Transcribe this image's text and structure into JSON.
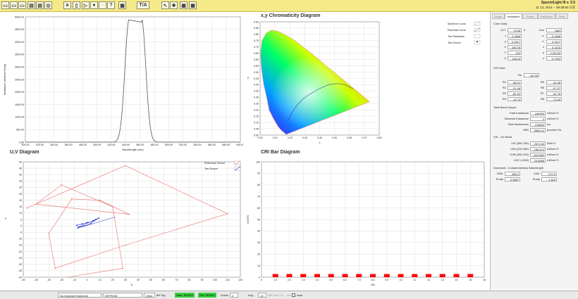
{
  "app": {
    "title": "SpectriLight III v. 3.5",
    "date": "11 13, 2014 -- 09:28:50 오후"
  },
  "toolbar": {
    "buttons": [
      {
        "name": "open-icon",
        "glyph": "▭"
      },
      {
        "name": "save-icon",
        "glyph": "▭"
      },
      {
        "name": "save-as-icon",
        "glyph": "▭"
      },
      {
        "name": "print-icon",
        "glyph": "▤"
      },
      {
        "name": "export-icon",
        "glyph": "▤"
      },
      {
        "name": "settings-icon",
        "glyph": "◎"
      },
      {
        "name": "text-icon",
        "glyph": "a"
      },
      {
        "name": "copy-icon",
        "glyph": "▯"
      },
      {
        "name": "run-icon",
        "glyph": "▷"
      },
      {
        "name": "record-icon",
        "glyph": "●"
      },
      {
        "name": "stop-icon",
        "glyph": "◌"
      },
      {
        "name": "help-icon",
        "glyph": "?"
      },
      {
        "name": "image-icon",
        "glyph": "▦"
      },
      {
        "name": "annotate-button",
        "glyph": "T/A"
      },
      {
        "name": "cursor-icon",
        "glyph": "↖"
      },
      {
        "name": "pan-icon",
        "glyph": "✥"
      },
      {
        "name": "zoom-icon",
        "glyph": "▦"
      },
      {
        "name": "autoscale-icon",
        "glyph": "▦"
      }
    ]
  },
  "spectrum": {
    "ylabel": "Irradiance (uW/cm^2/nm)",
    "xlabel": "Wavelength (nm)",
    "yticks": [
      "5000.00",
      "4500.00",
      "4000.00",
      "3500.00",
      "3000.00",
      "2500.00",
      "2000.00",
      "1500.00",
      "1000.00",
      "500.00",
      "0.00"
    ],
    "xticks": [
      "300.00",
      "320.00",
      "340.00",
      "360.00",
      "380.00",
      "400.00",
      "420.00",
      "440.00",
      "460.00",
      "480.00",
      "500.00",
      "520.00",
      "540.00",
      "560.00",
      "580.00",
      "600.00"
    ]
  },
  "cie": {
    "title": "x,y Chromaticity Diagram",
    "xlabel": "x",
    "ylabel": "y",
    "xticks": [
      "0.00",
      "0.10",
      "0.20",
      "0.30",
      "0.40",
      "0.50",
      "0.60",
      "0.70",
      "0.80"
    ],
    "yticks": [
      "0.90",
      "0.85",
      "0.80",
      "0.75",
      "0.70",
      "0.65",
      "0.60",
      "0.55",
      "0.50",
      "0.45",
      "0.40",
      "0.35",
      "0.30",
      "0.25",
      "0.20",
      "0.15",
      "0.10",
      "0.05",
      "0.00"
    ],
    "legend": [
      "Spectrum Locus",
      "Planckian Curve",
      "Test Standards",
      "Test Source"
    ]
  },
  "uv": {
    "title": "U,V Diagram",
    "xlabel": "U",
    "ylabel": "V",
    "xticks": [
      "-50",
      "-40",
      "-30",
      "-20",
      "-10",
      "0",
      "10",
      "20",
      "30",
      "40",
      "50",
      "60",
      "70",
      "80",
      "90",
      "100",
      "110",
      "120"
    ],
    "yticks": [
      "50",
      "45",
      "40",
      "35",
      "30",
      "25",
      "20",
      "15",
      "10",
      "5",
      "0",
      "-5",
      "-10",
      "-15",
      "-20",
      "-25",
      "-30",
      "-35",
      "-40"
    ],
    "legend": [
      "Reference Source",
      "Test Source"
    ]
  },
  "cri_bar": {
    "title": "CRI Bar Diagram",
    "xlabel": "Ra",
    "ylabel": "UNITS",
    "yticks": [
      "100",
      "90",
      "80",
      "70",
      "60",
      "50",
      "40",
      "30",
      "20",
      "10",
      "0"
    ],
    "xticks": [
      "0",
      "1.0",
      "2.0",
      "3.0",
      "4.0",
      "5.0",
      "6.0",
      "7.0",
      "8.0",
      "9.0",
      "10",
      "11",
      "12",
      "13",
      "14",
      "15",
      "16"
    ]
  },
  "panel": {
    "tabs": [
      "Graph",
      "Irradiance",
      "Power",
      "Radiance",
      "Peak"
    ],
    "color_data_label": "Color Data",
    "cct_label": "CCT",
    "cct_value": "5748",
    "k": "K",
    "duv_label": "Duv",
    "duv_value": "NaN",
    "left_rows": [
      {
        "l": "x",
        "v": "0.1686"
      },
      {
        "l": "y",
        "v": "0.1517"
      },
      {
        "l": "X",
        "v": "250.05"
      },
      {
        "l": "Y",
        "v": "100"
      },
      {
        "l": "Z",
        "v": "1184.8"
      }
    ],
    "right_rows": [
      {
        "l": "u'",
        "v": "0.1686"
      },
      {
        "l": "v'",
        "v": "0.1517"
      },
      {
        "l": "x",
        "v": "0.1433"
      },
      {
        "l": "y",
        "v": "0.05732"
      },
      {
        "l": "z",
        "v": "0.7994"
      }
    ],
    "cri_label": "CRI Data",
    "ra_label": "Ra",
    "ra_value": "-60.05",
    "cri_left": [
      {
        "l": "R1",
        "v": "-58.01"
      },
      {
        "l": "R2",
        "v": "-21.46"
      },
      {
        "l": "R3",
        "v": "-82.92"
      },
      {
        "l": "R4",
        "v": "-107.5"
      }
    ],
    "cri_right": [
      {
        "l": "R5",
        "v": "-40.98"
      },
      {
        "l": "R6",
        "v": "-57.07"
      },
      {
        "l": "R7",
        "v": "-32.78"
      },
      {
        "l": "R8",
        "v": "-72.50"
      }
    ],
    "band_label": "Total Band Output",
    "band_rows": [
      {
        "l": "Total Irradiance",
        "v": "165390",
        "u": "uW/cm^2"
      },
      {
        "l": "Selected Irradiance",
        "v": "0",
        "u": "uW/cm^2"
      },
      {
        "l": "Total Illuminance",
        "v": "139822",
        "u": "lux"
      },
      {
        "l": "PAR",
        "v": "5969.41",
        "u": "μmol/m^2/s"
      }
    ],
    "vis_label": "VIS - UV Band",
    "vis_rows": [
      {
        "l": "VIS (380-780)",
        "v": "2571.53",
        "u": "W/m^2"
      },
      {
        "l": "UVA (315-380)",
        "v": "166.613",
        "u": "uW/cm^2"
      },
      {
        "l": "UVB (280-315)",
        "v": "83.9480",
        "u": "uW/cm^2"
      },
      {
        "l": "UVC (<280)",
        "v": "29.5586",
        "u": "uW/cm^2"
      }
    ],
    "dom_label": "Dominant - Complementary Wavelength",
    "dwl_label": "DWL",
    "dwl_value": "458.0",
    "cwl_label": "CWL",
    "cwl_value": "572.0",
    "purity_label": "Purity",
    "purity_value": "0.9887",
    "purity2_label": "Purity",
    "purity2_value": "1.463"
  },
  "status": {
    "field1": "No Imported Spectrum",
    "field2": "EEPROM",
    "field3": "1964",
    "bit_label": "Bit Trig",
    "dark": "Dark: READY",
    "ref": "Ref: READY",
    "scans_label": "Scans",
    "scans_value": "2",
    "avg_label": "Avg",
    "avg_value": "10",
    "bitime": "Bit Time  1.0",
    "hz": "ms",
    "auto": "Auto"
  },
  "colors": {
    "toolbar": "#f6e98a",
    "uv_line": "#e8706a",
    "uv_test": "#2233cc",
    "bar": "#ff0000",
    "trace": "#555555"
  }
}
